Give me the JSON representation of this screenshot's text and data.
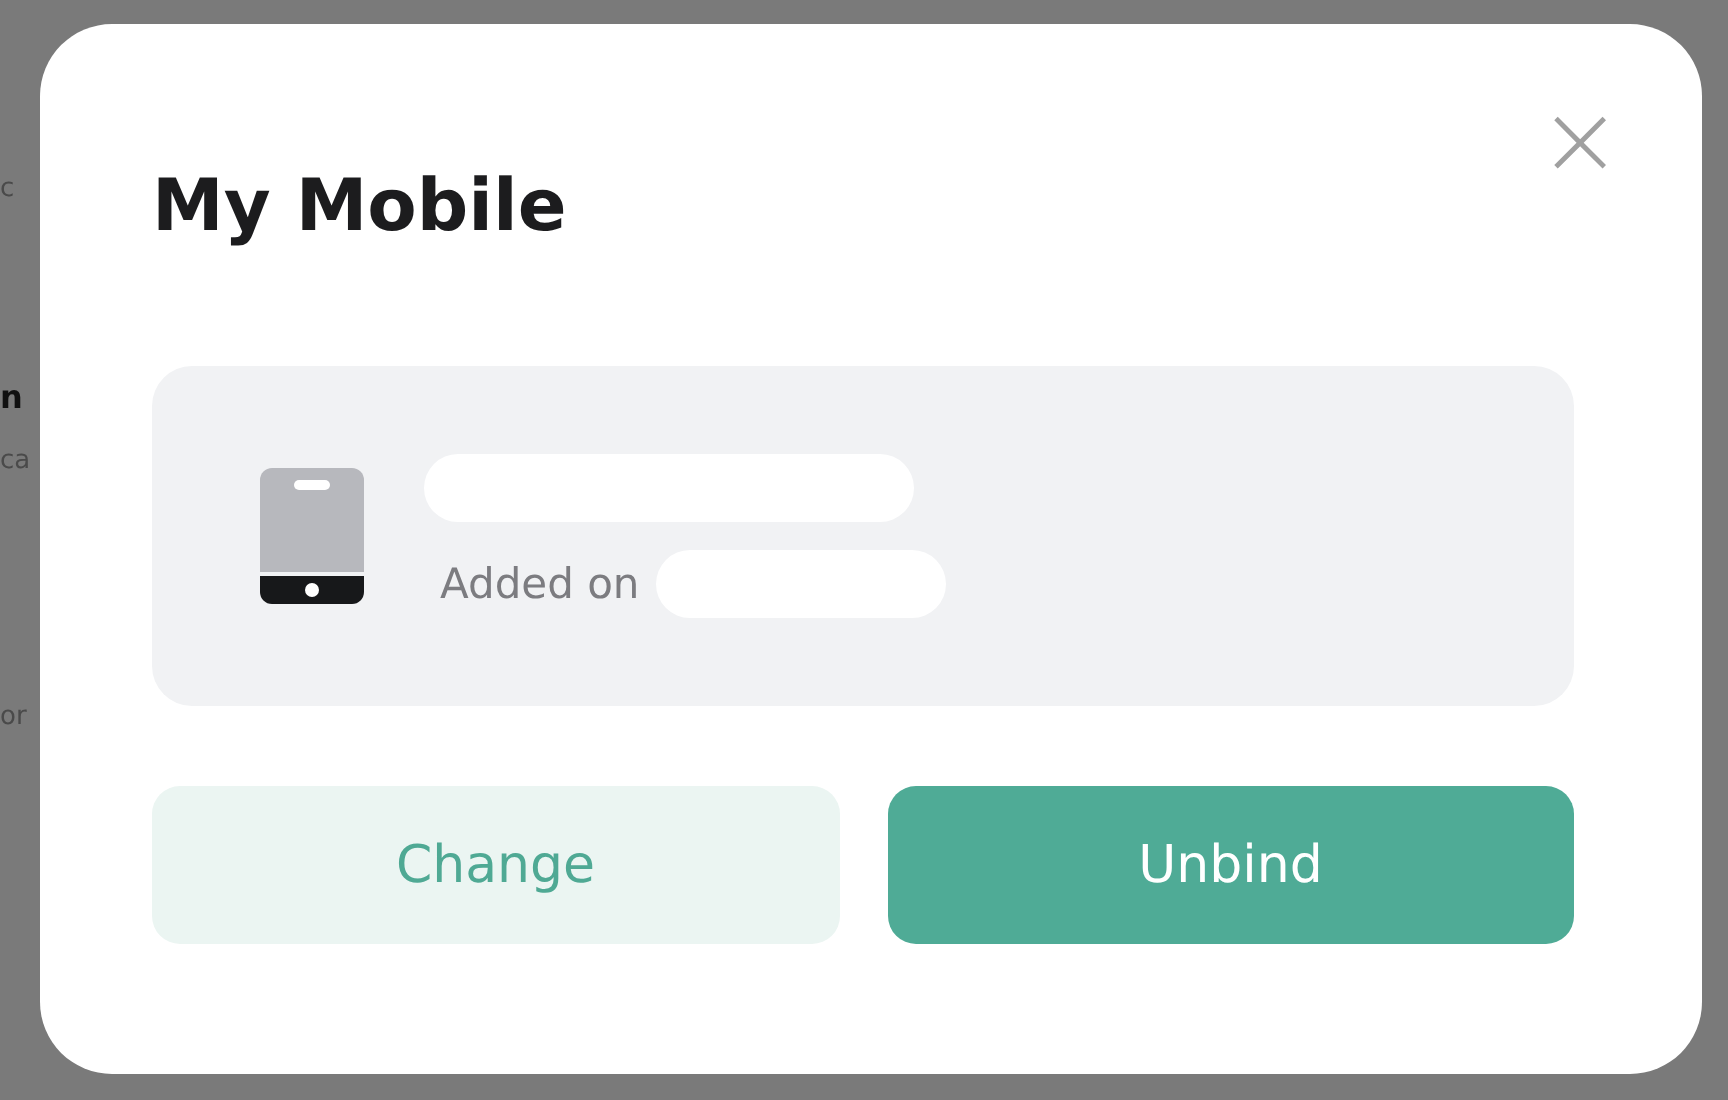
{
  "background": {
    "fragments": [
      {
        "text": "c",
        "kind": "muted"
      },
      {
        "text": "n",
        "kind": "strong"
      },
      {
        "text": "ca",
        "kind": "muted"
      },
      {
        "text": "or",
        "kind": "muted"
      }
    ]
  },
  "dialog": {
    "title": "My Mobile",
    "close": "×",
    "device": {
      "added_label": "Added on"
    },
    "buttons": [
      {
        "label": "Change",
        "kind": "secondary"
      },
      {
        "label": "Unbind",
        "kind": "primary"
      }
    ]
  }
}
